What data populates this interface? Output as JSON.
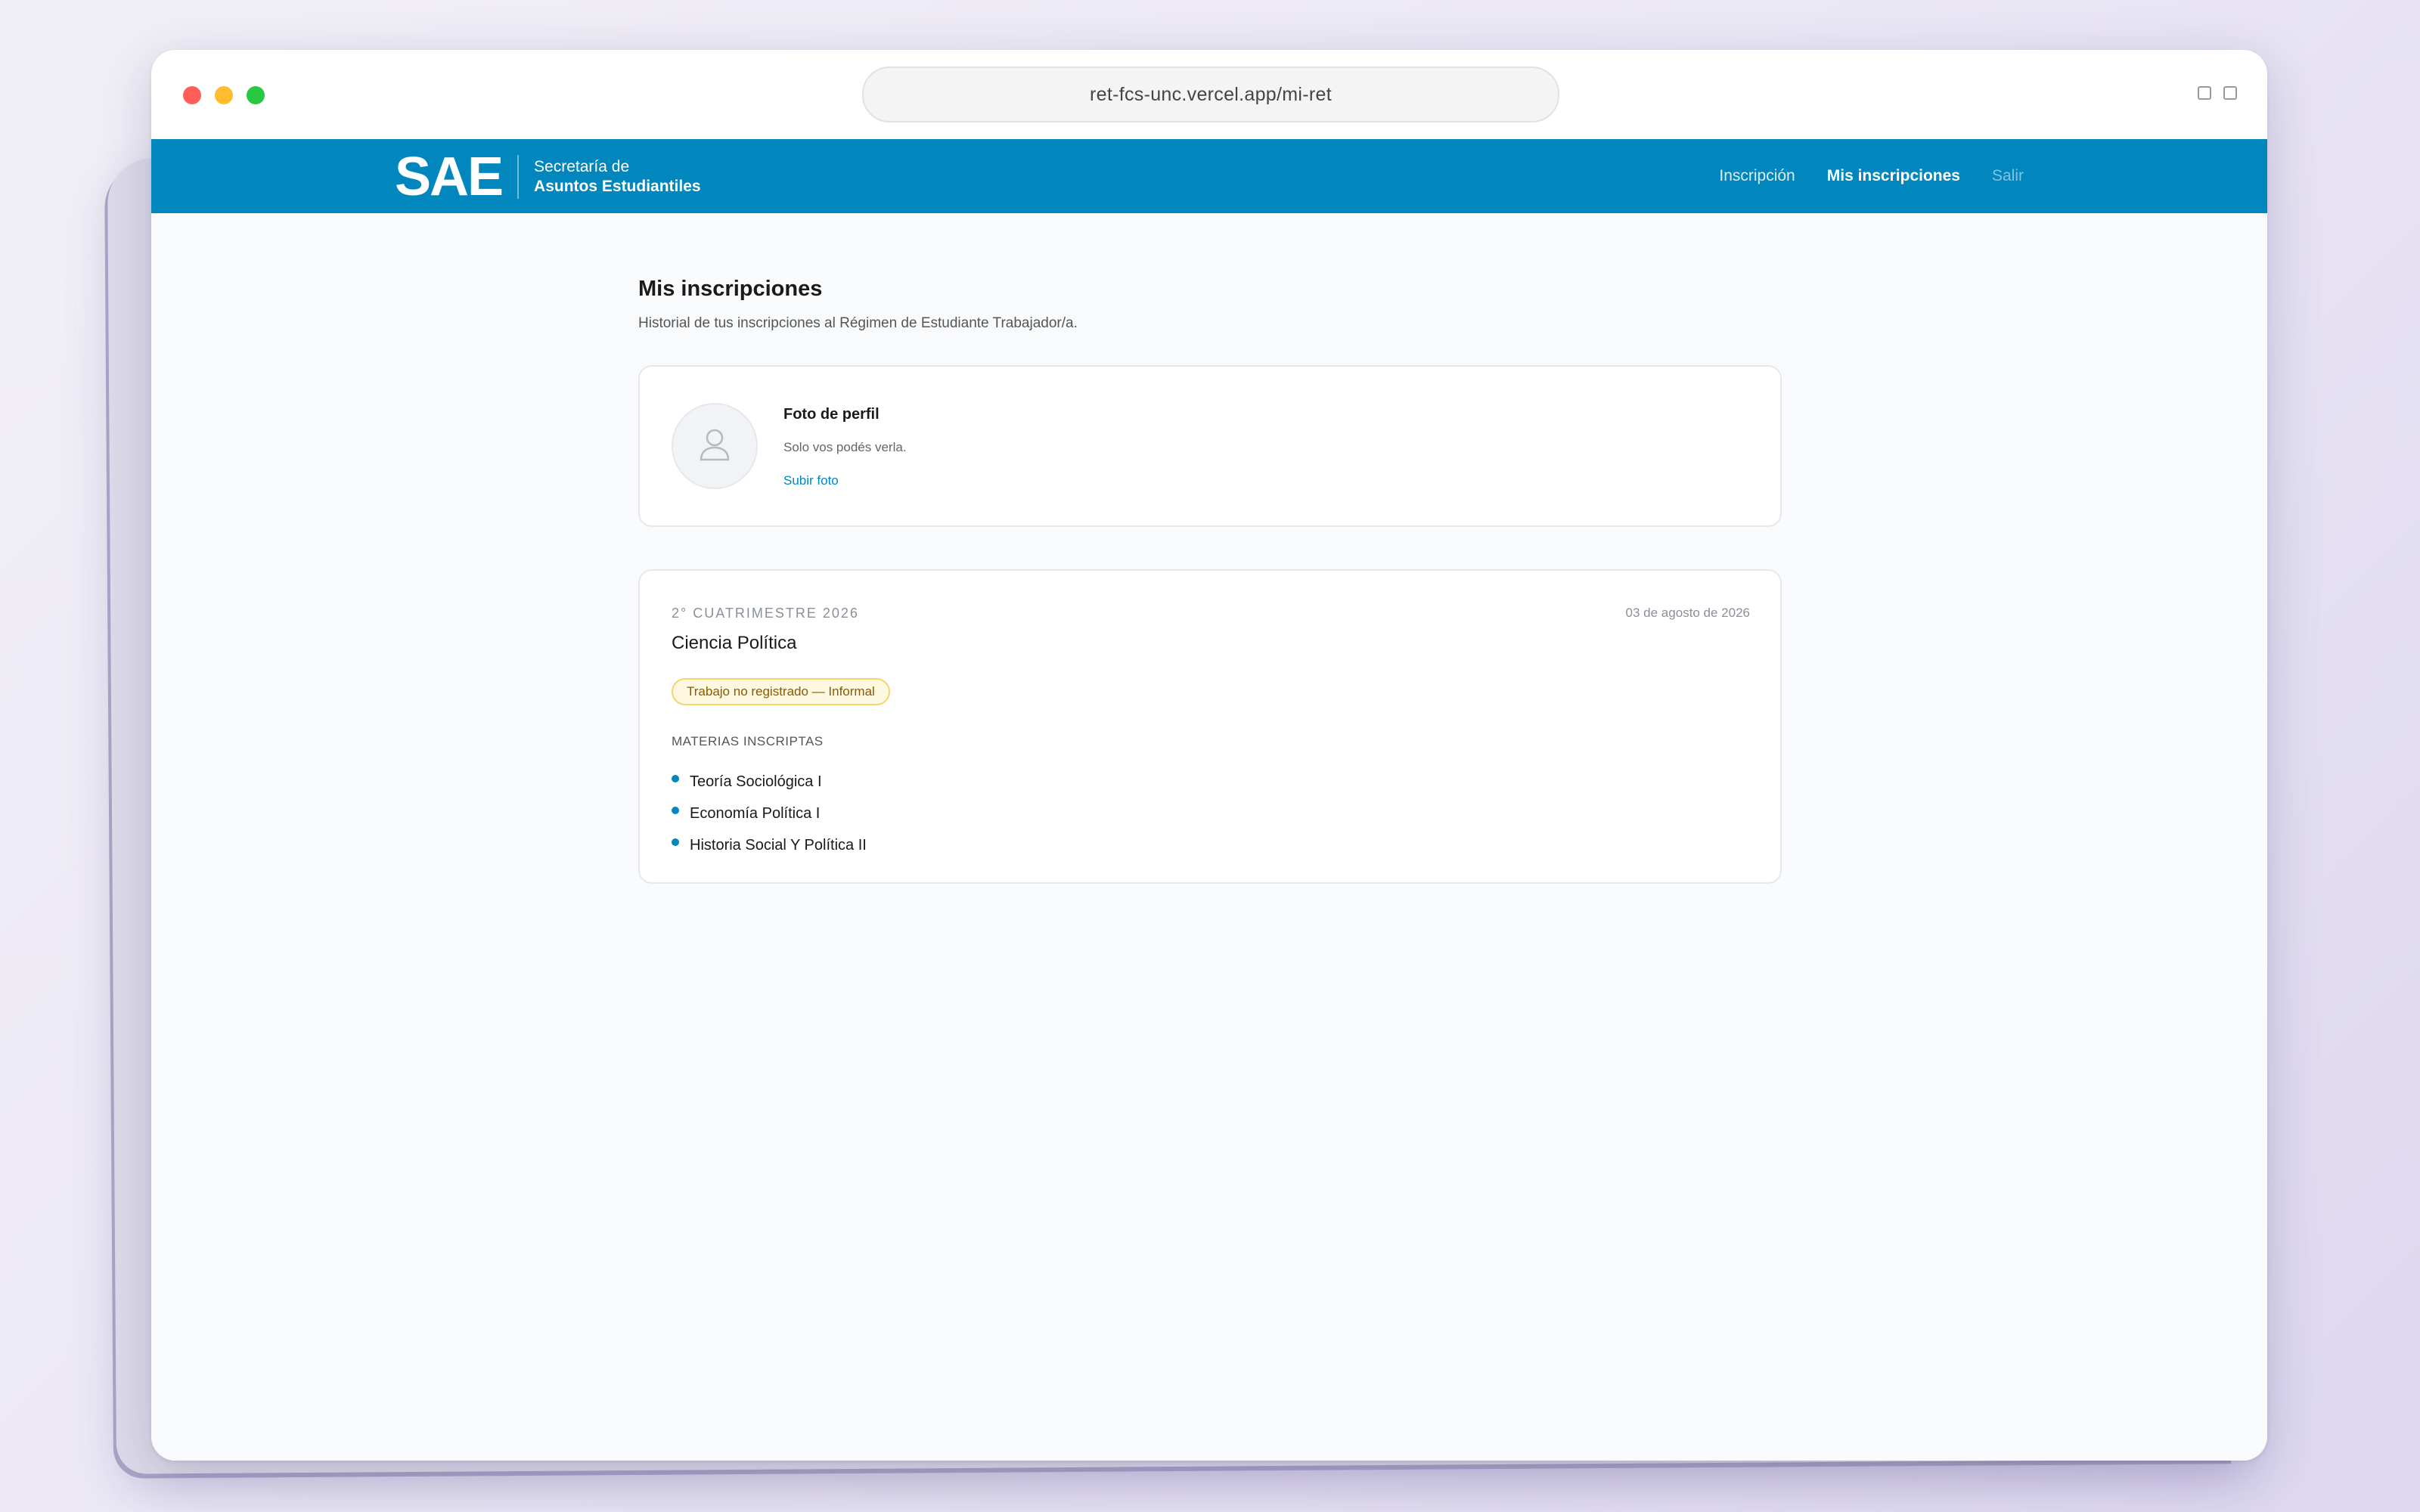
{
  "browser": {
    "url": "ret-fcs-unc.vercel.app/mi-ret"
  },
  "navbar": {
    "logo": "SAE",
    "brand_line1": "Secretaría de",
    "brand_line2": "Asuntos Estudiantiles",
    "links": [
      {
        "label": "Inscripción",
        "state": "normal"
      },
      {
        "label": "Mis inscripciones",
        "state": "active"
      },
      {
        "label": "Salir",
        "state": "dim"
      }
    ],
    "background_color": "#0187bd"
  },
  "page": {
    "title": "Mis inscripciones",
    "subtitle": "Historial de tus inscripciones al Régimen de Estudiante Trabajador/a."
  },
  "profile": {
    "title": "Foto de perfil",
    "note": "Solo vos podés verla.",
    "upload_link": "Subir foto",
    "avatar_icon": "user-placeholder-icon"
  },
  "enrollment": {
    "period": "2° CUATRIMESTRE 2026",
    "date": "03 de agosto de 2026",
    "career": "Ciencia Política",
    "badge": "Trabajo no registrado — Informal",
    "subjects_label": "MATERIAS INSCRIPTAS",
    "subjects": [
      "Teoría Sociológica I",
      "Economía Política I",
      "Historia Social Y Política II"
    ]
  }
}
